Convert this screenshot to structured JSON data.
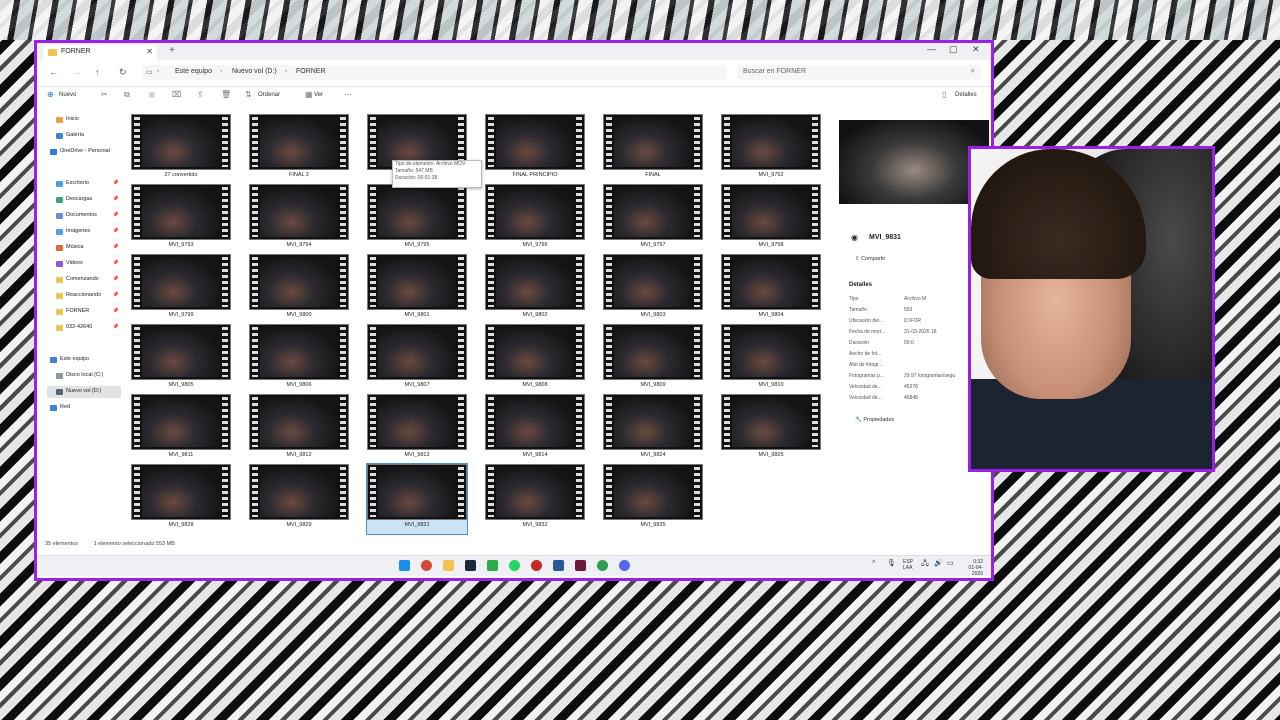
{
  "window": {
    "tab_title": "FORNER",
    "new_tab": "+",
    "controls": [
      "—",
      "▢",
      "✕"
    ]
  },
  "address": {
    "crumbs": [
      "Este equipo",
      "Nuevo vol (D:)",
      "FORNER"
    ],
    "search_placeholder": "Buscar en FORNER"
  },
  "command_bar": {
    "new_label": "Nuevo",
    "sort_label": "Ordenar",
    "view_label": "Ver",
    "more_label": "···",
    "details_label": "Detalles"
  },
  "nav": [
    {
      "label": "Inicio",
      "color": "#e8a33d",
      "pin": false
    },
    {
      "label": "Galería",
      "color": "#3a86d4",
      "pin": false
    },
    {
      "label": "OneDrive - Personal",
      "color": "#2b7cd3",
      "pin": false
    },
    {
      "label": "Escritorio",
      "color": "#4a9fe0",
      "pin": true
    },
    {
      "label": "Descargas",
      "color": "#3fa46a",
      "pin": true
    },
    {
      "label": "Documentos",
      "color": "#6c8bd0",
      "pin": true
    },
    {
      "label": "Imágenes",
      "color": "#4fa3d9",
      "pin": true
    },
    {
      "label": "Música",
      "color": "#e0693a",
      "pin": true
    },
    {
      "label": "Videos",
      "color": "#8a5bd6",
      "pin": true
    },
    {
      "label": "Comenzando",
      "color": "#f2c14e",
      "pin": true
    },
    {
      "label": "Reaccionando",
      "color": "#f2c14e",
      "pin": true
    },
    {
      "label": "FORNER",
      "color": "#f2c14e",
      "pin": true
    },
    {
      "label": "032-42640",
      "color": "#f2c14e",
      "pin": true
    },
    {
      "label": "Este equipo",
      "color": "#3a86d4",
      "pin": false
    },
    {
      "label": "Disco local (C:)",
      "color": "#8899aa",
      "pin": false
    },
    {
      "label": "Nuevo vol (D:)",
      "color": "#556677",
      "pin": false
    },
    {
      "label": "Red",
      "color": "#3a86d4",
      "pin": false
    }
  ],
  "files": [
    "27 convertido",
    "FINAL 2",
    "",
    "FINAL PRINCIPIO",
    "FINAL",
    "MVI_9792",
    "MVI_9793",
    "MVI_9794",
    "MVI_9795",
    "MVI_9796",
    "MVI_9797",
    "MVI_9798",
    "MVI_9799",
    "MVI_9800",
    "MVI_9801",
    "MVI_9802",
    "MVI_9803",
    "MVI_9804",
    "MVI_9805",
    "MVI_9806",
    "MVI_9807",
    "MVI_9808",
    "MVI_9809",
    "MVI_9810",
    "MVI_9811",
    "MVI_9812",
    "MVI_9813",
    "MVI_9814",
    "MVI_9824",
    "MVI_9825",
    "MVI_9828",
    "MVI_9829",
    "MVI_9831",
    "MVI_9832",
    "MVI_9835"
  ],
  "selected_index": 32,
  "tooltip": {
    "line1": "Tipo de elemento: Archivo MOV",
    "line2": "Tamaño: 547 MB",
    "line3": "Duración: 00:01:38"
  },
  "details": {
    "name": "MVI_9831",
    "share_label": "Compartir",
    "heading": "Detalles",
    "rows": [
      {
        "k": "Tipo",
        "v": "Archivo M"
      },
      {
        "k": "Tamaño",
        "v": "553"
      },
      {
        "k": "Ubicación del...",
        "v": "D:\\FOR"
      },
      {
        "k": "Fecha de mod...",
        "v": "31-03-2026 18"
      },
      {
        "k": "Duración",
        "v": "00:0"
      },
      {
        "k": "Ancho de fot...",
        "v": ""
      },
      {
        "k": "Alto de fotogr...",
        "v": ""
      },
      {
        "k": "Fotogramas p...",
        "v": "29.97 fotogramas/segu"
      },
      {
        "k": "Velocidad de...",
        "v": "45378"
      },
      {
        "k": "Velocidad de...",
        "v": "46848"
      }
    ],
    "properties_label": "Propiedades"
  },
  "status": {
    "count": "35 elementos",
    "selection": "1 elemento seleccionado  553 MB"
  },
  "taskbar": {
    "lang": "ESP",
    "lang2": "LAA",
    "time": "0:32",
    "date": "01-04-2026"
  }
}
